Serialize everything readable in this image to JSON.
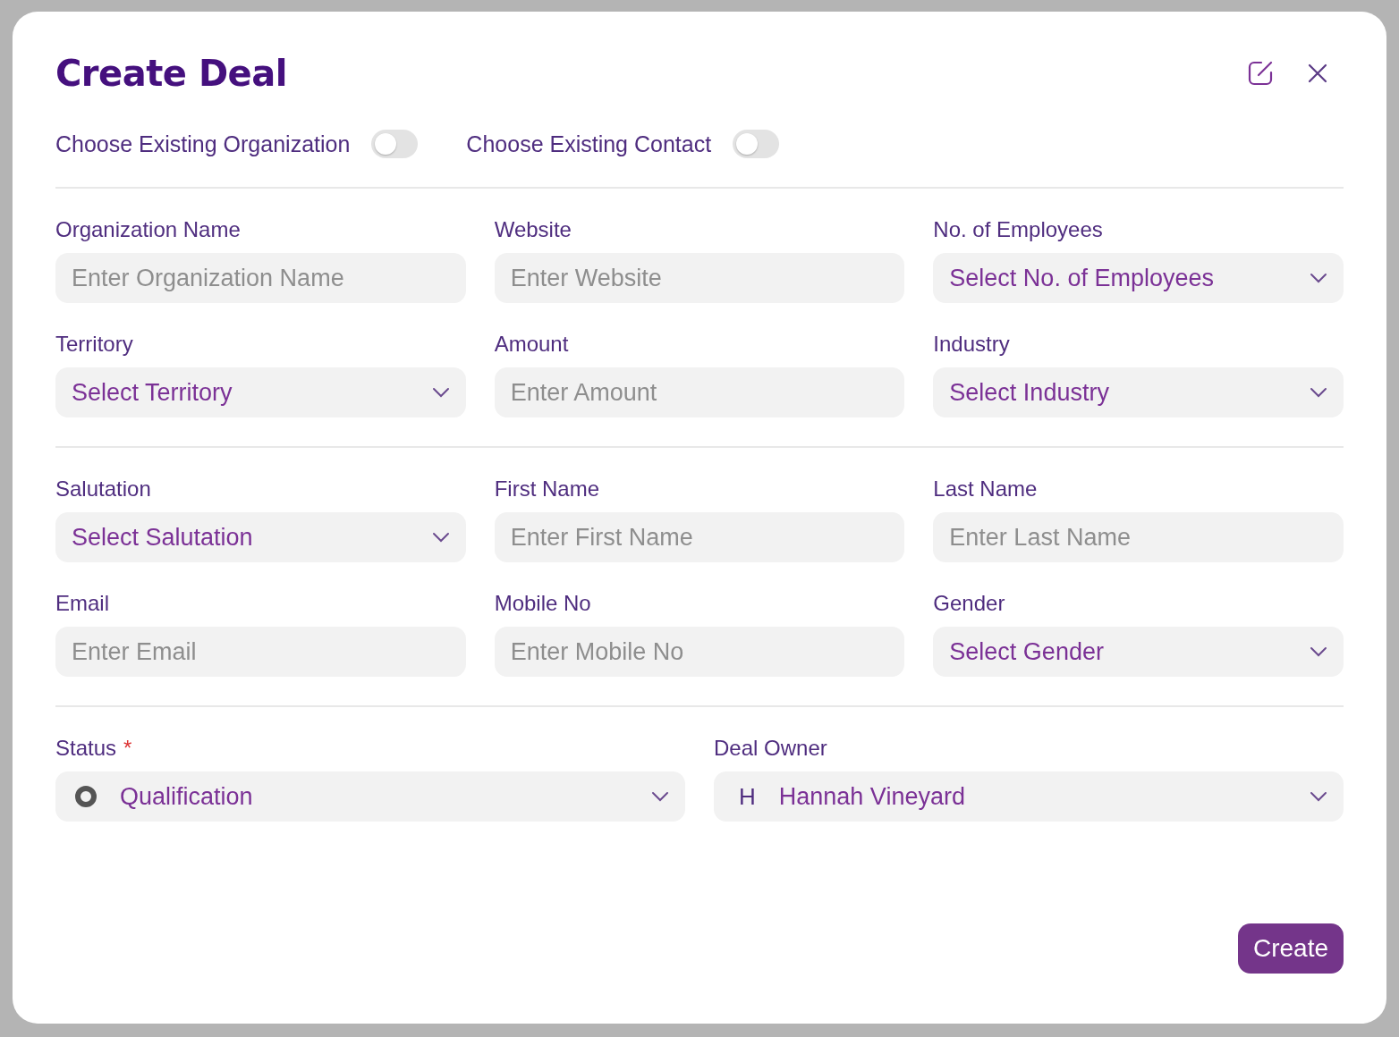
{
  "dialog": {
    "title": "Create Deal"
  },
  "toggles": [
    {
      "label": "Choose Existing Organization",
      "on": false
    },
    {
      "label": "Choose Existing Contact",
      "on": false
    }
  ],
  "sections": [
    {
      "fields": [
        {
          "kind": "input",
          "label": "Organization Name",
          "placeholder": "Enter Organization Name"
        },
        {
          "kind": "input",
          "label": "Website",
          "placeholder": "Enter Website"
        },
        {
          "kind": "select",
          "label": "No. of Employees",
          "placeholder": "Select No. of Employees"
        },
        {
          "kind": "select",
          "label": "Territory",
          "placeholder": "Select Territory"
        },
        {
          "kind": "input",
          "label": "Amount",
          "placeholder": "Enter Amount"
        },
        {
          "kind": "select",
          "label": "Industry",
          "placeholder": "Select Industry"
        }
      ]
    },
    {
      "fields": [
        {
          "kind": "select",
          "label": "Salutation",
          "placeholder": "Select Salutation"
        },
        {
          "kind": "input",
          "label": "First Name",
          "placeholder": "Enter First Name"
        },
        {
          "kind": "input",
          "label": "Last Name",
          "placeholder": "Enter Last Name"
        },
        {
          "kind": "input",
          "label": "Email",
          "placeholder": "Enter Email"
        },
        {
          "kind": "input",
          "label": "Mobile No",
          "placeholder": "Enter Mobile No"
        },
        {
          "kind": "select",
          "label": "Gender",
          "placeholder": "Select Gender"
        }
      ]
    },
    {
      "fields": [
        {
          "kind": "status",
          "label": "Status",
          "required_mark": "*",
          "value": "Qualification"
        },
        {
          "kind": "user",
          "label": "Deal Owner",
          "initial": "H",
          "value": "Hannah Vineyard"
        }
      ]
    }
  ],
  "buttons": [
    {
      "label": "Create"
    }
  ]
}
